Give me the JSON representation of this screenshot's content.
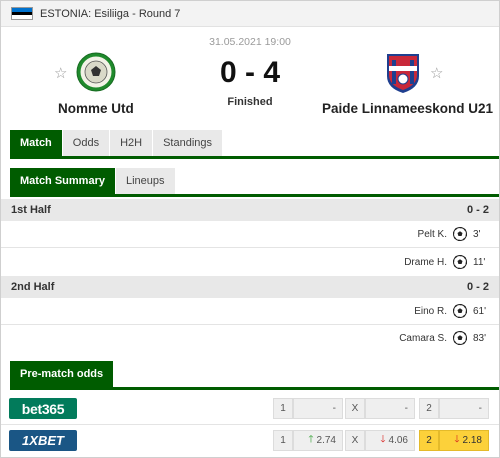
{
  "header": {
    "title": "ESTONIA: Esiliiga - Round 7",
    "flag_colors": [
      "#0072ce",
      "#000000",
      "#ffffff"
    ]
  },
  "match": {
    "date": "31.05.2021 19:00",
    "score": "0 - 4",
    "status": "Finished",
    "home": {
      "name": "Nomme Utd",
      "logo_icon": "nomme-utd-crest-icon"
    },
    "away": {
      "name": "Paide Linnameeskond U21",
      "logo_icon": "paide-crest-icon"
    }
  },
  "tabs": [
    "Match",
    "Odds",
    "H2H",
    "Standings"
  ],
  "subtabs": [
    "Match Summary",
    "Lineups"
  ],
  "halves": [
    {
      "label": "1st Half",
      "score": "0 - 2",
      "events": [
        {
          "player": "Pelt K.",
          "minute": "3'"
        },
        {
          "player": "Drame H.",
          "minute": "11'"
        }
      ]
    },
    {
      "label": "2nd Half",
      "score": "0 - 2",
      "events": [
        {
          "player": "Eino R.",
          "minute": "61'"
        },
        {
          "player": "Camara S.",
          "minute": "83'"
        }
      ]
    }
  ],
  "odds": {
    "title": "Pre-match odds",
    "labels": [
      "1",
      "X",
      "2"
    ],
    "bookmakers": [
      {
        "name": "bet365",
        "color": "#027b5b",
        "values": [
          "-",
          "-",
          "-"
        ],
        "trends": [
          "",
          "",
          ""
        ]
      },
      {
        "name": "1XBET",
        "color": "#1a5685",
        "values": [
          "2.74",
          "4.06",
          "2.18"
        ],
        "trends": [
          "up",
          "down",
          "down"
        ]
      }
    ]
  },
  "colors": {
    "accent": "#005c00",
    "up": "#2e9e2e",
    "down": "#d8221f",
    "highlight": "#fcd13a"
  }
}
